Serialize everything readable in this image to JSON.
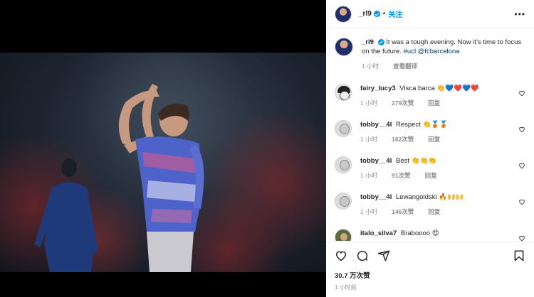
{
  "header": {
    "username": "_rl9",
    "separator": "•",
    "follow_label": "关注",
    "more_label": "•••"
  },
  "caption": {
    "username": "_rl9",
    "text": "It was a tough evening. Now it’s time to focus on the future.",
    "hashtag": "#ucl",
    "mention": "@fcbarcelona",
    "time": "1 小时",
    "translate_label": "查看翻译"
  },
  "comments": [
    {
      "username": "fairy_lucy3",
      "text": "Visca barca",
      "emojis": [
        "👏",
        "💙",
        "❤️",
        "💙",
        "❤️"
      ],
      "time": "1 小时",
      "likes": "279次赞",
      "reply": "回复"
    },
    {
      "username": "tobby__4l",
      "text": "Respect",
      "emojis": [
        "👏",
        "🥉",
        "🥉"
      ],
      "time": "1 小时",
      "likes": "162次赞",
      "reply": "回复"
    },
    {
      "username": "tobby__4l",
      "text": "Best",
      "emojis": [
        "👏",
        "👏",
        "👏"
      ],
      "time": "1 小时",
      "likes": "91次赞",
      "reply": "回复"
    },
    {
      "username": "tobby__4l",
      "text": "Lewangoldski",
      "emojis": [
        "🔥",
        "🙌",
        "🙌"
      ],
      "time": "1 小时",
      "likes": "146次赞",
      "reply": "回复"
    },
    {
      "username": "italo_silva7",
      "text": "Braboooo",
      "emojis": [
        "😍"
      ],
      "time": "",
      "likes": "",
      "reply": ""
    }
  ],
  "footer": {
    "likes": "30.7 万次赞",
    "time": "1 小时前"
  },
  "icons": [
    "heart-icon",
    "comment-icon",
    "share-icon",
    "bookmark-icon"
  ],
  "colors": {
    "accent": "#0095f6",
    "verified": "#0095f6",
    "muted": "#8e8e8e"
  }
}
